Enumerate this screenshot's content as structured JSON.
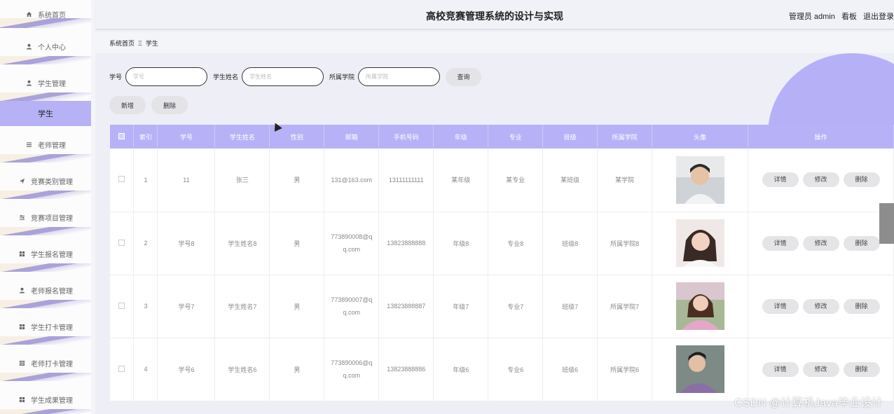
{
  "app": {
    "title": "高校竞赛管理系统的设计与实现",
    "user_label": "管理员 admin",
    "board_link": "看板",
    "logout_link": "退出登录"
  },
  "sidebar": {
    "items": [
      {
        "label": "系统首页",
        "icon": "home-icon"
      },
      {
        "label": "个人中心",
        "icon": "user-icon"
      },
      {
        "label": "学生管理",
        "icon": "user-icon"
      },
      {
        "label": "学生",
        "icon": ""
      },
      {
        "label": "老师管理",
        "icon": "list-icon"
      },
      {
        "label": "竞赛类别管理",
        "icon": "send-icon"
      },
      {
        "label": "竞赛项目管理",
        "icon": "sliders-icon"
      },
      {
        "label": "学生报名管理",
        "icon": "grid-icon"
      },
      {
        "label": "老师报名管理",
        "icon": "user-icon"
      },
      {
        "label": "学生打卡管理",
        "icon": "grid-icon"
      },
      {
        "label": "老师打卡管理",
        "icon": "grid-icon"
      },
      {
        "label": "学生成果管理",
        "icon": "grid-icon"
      }
    ]
  },
  "breadcrumb": {
    "home": "系统首页",
    "separator": "Ξ",
    "current": "学生"
  },
  "search": {
    "fields": [
      {
        "label": "学号",
        "placeholder": "学号"
      },
      {
        "label": "学生姓名",
        "placeholder": "学生姓名"
      },
      {
        "label": "所属学院",
        "placeholder": "所属学院"
      }
    ],
    "query_button": "查询"
  },
  "actions": {
    "add": "新增",
    "delete": "删除"
  },
  "table": {
    "columns": [
      "索引",
      "学号",
      "学生姓名",
      "性别",
      "邮箱",
      "手机号码",
      "年级",
      "专业",
      "班级",
      "所属学院",
      "头像",
      "操作"
    ],
    "op_labels": {
      "detail": "详情",
      "edit": "修改",
      "delete": "删除"
    },
    "rows": [
      {
        "index": "1",
        "id": "11",
        "name": "张三",
        "gender": "男",
        "email": "131@163.com",
        "phone": "13111111111",
        "grade": "某年级",
        "major": "某专业",
        "class": "某班级",
        "college": "某学院"
      },
      {
        "index": "2",
        "id": "学号8",
        "name": "学生姓名8",
        "gender": "男",
        "email": "773890008@qq.com",
        "phone": "13823888888",
        "grade": "年级8",
        "major": "专业8",
        "class": "班级8",
        "college": "所属学院8"
      },
      {
        "index": "3",
        "id": "学号7",
        "name": "学生姓名7",
        "gender": "男",
        "email": "773890007@qq.com",
        "phone": "13823888887",
        "grade": "年级7",
        "major": "专业7",
        "class": "班级7",
        "college": "所属学院7"
      },
      {
        "index": "4",
        "id": "学号6",
        "name": "学生姓名6",
        "gender": "男",
        "email": "773890006@qq.com",
        "phone": "13823888886",
        "grade": "年级6",
        "major": "专业6",
        "class": "班级6",
        "college": "所属学院6"
      }
    ]
  },
  "watermark": "CSDN @计算机Java毕业设计",
  "colors": {
    "accent": "#b7b2f7",
    "sidebar_active": "#b7b2f5",
    "decor": "#a9a3d9"
  }
}
